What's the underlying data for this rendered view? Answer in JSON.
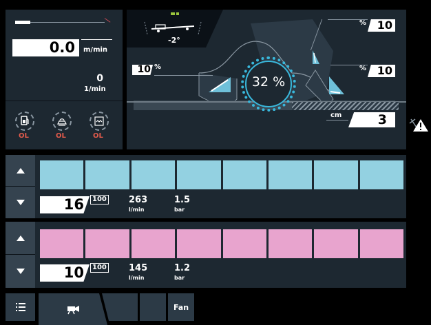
{
  "speed": {
    "value": "0.0",
    "unit": "m/min"
  },
  "rpm": {
    "value": "0",
    "unit": "1/min"
  },
  "gauges": [
    {
      "name": "fuel-level-icon",
      "label": "OL"
    },
    {
      "name": "fluid-level-icon",
      "label": "OL"
    },
    {
      "name": "tank-level-icon",
      "label": "OL"
    }
  ],
  "tilt": {
    "value": "-2°"
  },
  "auger": {
    "left_percent": "10",
    "left_unit": "%",
    "right_top_percent": "10",
    "right_top_unit": "%",
    "right_bottom_percent": "10",
    "right_bottom_unit": "%",
    "center_percent": "32 %",
    "height_unit": "cm",
    "height_value": "3"
  },
  "warning": {
    "icon": "warning-triangle-icon"
  },
  "conveyors": [
    {
      "color": "#93d1e1",
      "value": "16",
      "max": "100",
      "flow": "263",
      "flow_unit": "l/min",
      "pressure": "1.5",
      "pressure_unit": "bar"
    },
    {
      "color": "#e8a4ce",
      "value": "10",
      "max": "100",
      "flow": "145",
      "flow_unit": "l/min",
      "pressure": "1.2",
      "pressure_unit": "bar"
    }
  ],
  "bottom_tabs": {
    "menu_icon": "list-menu-icon",
    "camera_icon": "camera-icon",
    "fan_label": "Fan"
  }
}
